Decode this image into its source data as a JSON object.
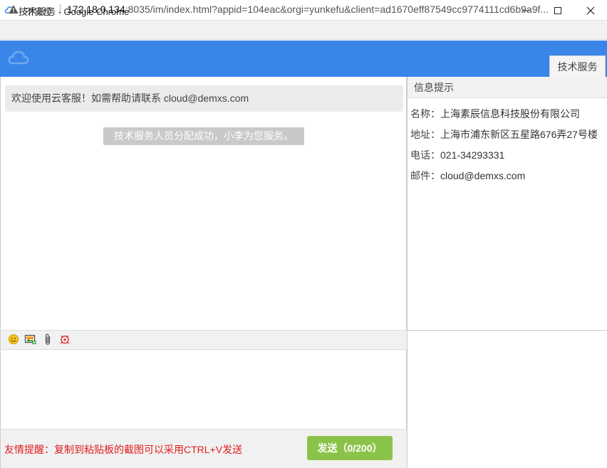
{
  "window": {
    "title": "技术服务 - Google Chrome",
    "insecure_label": "不安全",
    "url_host": "172.18.0.134",
    "url_rest": ":8035/im/index.html?appid=104eac&orgi=yunkefu&client=ad1670eff87549cc9774111cd6b9a9f..."
  },
  "header": {
    "tab_label": "技术服务",
    "brand_color": "#3a86e8"
  },
  "chat": {
    "welcome": "欢迎使用云客服！如需帮助请联系 cloud@demxs.com",
    "system_message": "技术服务人员分配成功，小李为您服务。"
  },
  "info": {
    "heading": "信息提示",
    "name_label": "名称：",
    "name_value": "上海素辰信息科技股份有限公司",
    "address_label": "地址：",
    "address_value": "上海市浦东新区五星路676弄27号楼",
    "phone_label": "电话：",
    "phone_value": "021-34293331",
    "email_label": "邮件：",
    "email_value": "cloud@demxs.com"
  },
  "composer": {
    "input_value": "",
    "tip": "友情提醒：复制到粘贴板的截图可以采用CTRL+V发送",
    "send_label": "发送（0/200）",
    "tools": [
      "emoji-icon",
      "image-icon",
      "attachment-icon",
      "screenshot-icon"
    ]
  }
}
